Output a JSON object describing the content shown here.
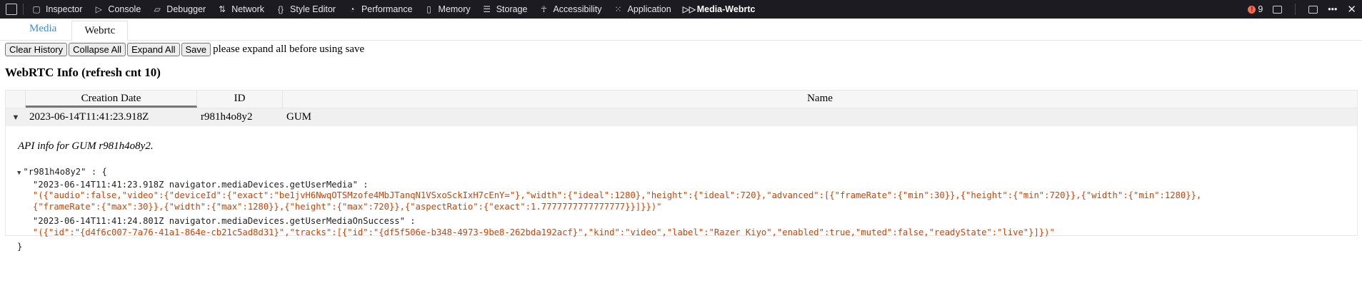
{
  "toolbar": {
    "tools": [
      {
        "label": "Inspector",
        "icon": "inspector-icon",
        "glyph": "▢"
      },
      {
        "label": "Console",
        "icon": "console-icon",
        "glyph": "▷"
      },
      {
        "label": "Debugger",
        "icon": "debugger-icon",
        "glyph": "▱"
      },
      {
        "label": "Network",
        "icon": "network-icon",
        "glyph": "⇅"
      },
      {
        "label": "Style Editor",
        "icon": "style-editor-icon",
        "glyph": "{}"
      },
      {
        "label": "Performance",
        "icon": "performance-icon",
        "glyph": "◔"
      },
      {
        "label": "Memory",
        "icon": "memory-icon",
        "glyph": "▯"
      },
      {
        "label": "Storage",
        "icon": "storage-icon",
        "glyph": "☰"
      },
      {
        "label": "Accessibility",
        "icon": "accessibility-icon",
        "glyph": "☥"
      },
      {
        "label": "Application",
        "icon": "application-icon",
        "glyph": "⁙"
      },
      {
        "label": "Media-Webrtc",
        "icon": "media-webrtc-icon",
        "glyph": "▷▷",
        "active": true
      }
    ],
    "error_count": "9",
    "error_color": "#ff6a4d",
    "background": "#1c1b22"
  },
  "tabs": [
    {
      "label": "Media",
      "color": "#3a8ed8"
    },
    {
      "label": "Webrtc",
      "selected": true
    }
  ],
  "buttons": {
    "clear_history": "Clear History",
    "collapse_all": "Collapse All",
    "expand_all": "Expand All",
    "save": "Save"
  },
  "hint": "please expand all before using save",
  "heading": "WebRTC Info (refresh cnt 10)",
  "table": {
    "columns": [
      "Creation Date",
      "ID",
      "Name"
    ],
    "rows": [
      {
        "date": "2023-06-14T11:41:23.918Z",
        "id": "r981h4o8y2",
        "name": "GUM"
      }
    ]
  },
  "detail": {
    "title": "API info for GUM r981h4o8y2.",
    "root_key": "\"r981h4o8y2\"",
    "root_open": ": {",
    "root_close": "}",
    "entries": [
      {
        "key": "\"2023-06-14T11:41:23.918Z navigator.mediaDevices.getUserMedia\" :",
        "value_line1": "\"({\"audio\":false,\"video\":{\"deviceId\":{\"exact\":\"be1jvH6NwqOTSMzofe4MbJTanqN1VSxoSckIxH7cEnY=\"},\"width\":{\"ideal\":1280},\"height\":{\"ideal\":720},\"advanced\":[{\"frameRate\":{\"min\":30}},{\"height\":{\"min\":720}},{\"width\":{\"min\":1280}},",
        "value_line2": "{\"frameRate\":{\"max\":30}},{\"width\":{\"max\":1280}},{\"height\":{\"max\":720}},{\"aspectRatio\":{\"exact\":1.7777777777777777}}]}})\""
      },
      {
        "key": "\"2023-06-14T11:41:24.801Z navigator.mediaDevices.getUserMediaOnSuccess\" :",
        "value_line1": "\"({\"id\":\"{d4f6c007-7a76-41a1-864e-cb21c5ad8d31}\",\"tracks\":[{\"id\":\"{df5f506e-b348-4973-9be8-262bda192acf}\",\"kind\":\"video\",\"label\":\"Razer Kiyo\",\"enabled\":true,\"muted\":false,\"readyState\":\"live\"}]})\"",
        "value_line2": ""
      }
    ]
  }
}
